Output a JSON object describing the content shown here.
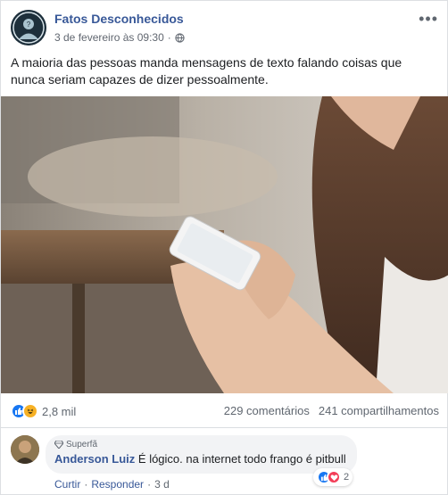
{
  "header": {
    "page_name": "Fatos Desconhecidos",
    "timestamp": "3 de fevereiro às 09:30",
    "separator": "·",
    "privacy_icon": "globe-icon",
    "more_label": "•••"
  },
  "post": {
    "text": "A maioria das pessoas manda mensagens de texto falando coisas que nunca seriam capazes de dizer pessoalmente."
  },
  "stats": {
    "reactions_count": "2,8 mil",
    "comments": "229 comentários",
    "shares": "241 compartilhamentos",
    "reaction_icons": [
      "like-icon",
      "haha-icon"
    ]
  },
  "comment": {
    "badge": "Superfã",
    "author": "Anderson Luiz",
    "text": "É lógico. na internet todo frango é pitbull",
    "reactions_count": "2",
    "reaction_icons": [
      "like-icon",
      "love-icon"
    ],
    "actions": {
      "like": "Curtir",
      "separator": "·",
      "reply": "Responder",
      "age": "3 d"
    }
  },
  "colors": {
    "link": "#385898",
    "like": "#1877f2",
    "haha": "#f7b125",
    "love": "#f33e58"
  }
}
